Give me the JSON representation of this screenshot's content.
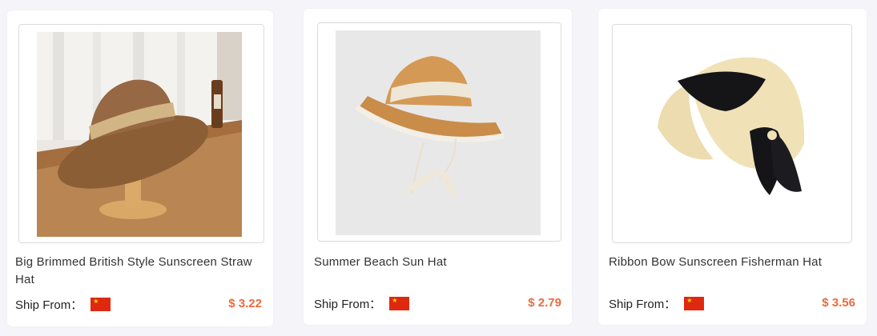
{
  "products": [
    {
      "title": "Big Brimmed British Style Sunscreen Straw Hat",
      "ship_label": "Ship From：",
      "flag_icon": "china-flag-icon",
      "price": "$ 3.22",
      "image": "brown-fedora-straw-hat-photo"
    },
    {
      "title": "Summer Beach Sun Hat",
      "ship_label": "Ship From：",
      "flag_icon": "china-flag-icon",
      "price": "$ 2.79",
      "image": "lace-trim-bucket-hat-photo"
    },
    {
      "title": "Ribbon Bow Sunscreen Fisherman Hat",
      "ship_label": "Ship From：",
      "flag_icon": "china-flag-icon",
      "price": "$ 3.56",
      "image": "cream-ribbon-bow-hat-photo"
    }
  ],
  "colors": {
    "price": "#ef6a3c",
    "flag_red": "#de2910",
    "flag_star": "#ffde00"
  }
}
